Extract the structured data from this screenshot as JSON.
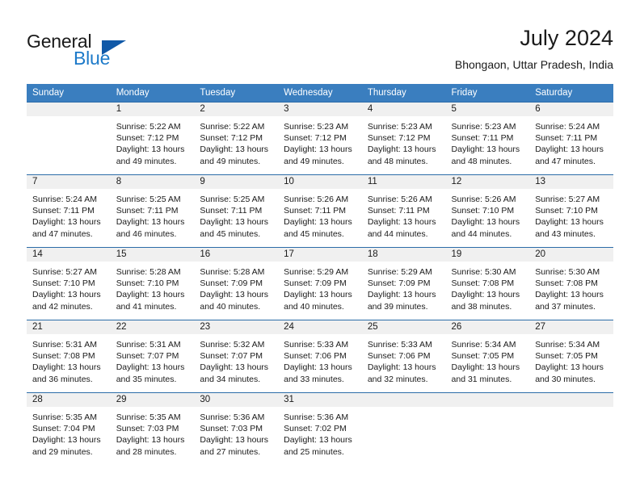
{
  "logo": {
    "word1": "General",
    "word2": "Blue",
    "accent_color": "#1d7ac9",
    "triangle_color": "#1059a8"
  },
  "header": {
    "title": "July 2024",
    "subtitle": "Bhongaon, Uttar Pradesh, India"
  },
  "calendar": {
    "header_bg": "#3a7ebf",
    "daynum_bg": "#f0f0f0",
    "row_border": "#2c6ca8",
    "weekday_headers": [
      "Sunday",
      "Monday",
      "Tuesday",
      "Wednesday",
      "Thursday",
      "Friday",
      "Saturday"
    ],
    "weeks": [
      [
        {
          "day": "",
          "sunrise": "",
          "sunset": "",
          "daylight1": "",
          "daylight2": ""
        },
        {
          "day": "1",
          "sunrise": "Sunrise: 5:22 AM",
          "sunset": "Sunset: 7:12 PM",
          "daylight1": "Daylight: 13 hours",
          "daylight2": "and 49 minutes."
        },
        {
          "day": "2",
          "sunrise": "Sunrise: 5:22 AM",
          "sunset": "Sunset: 7:12 PM",
          "daylight1": "Daylight: 13 hours",
          "daylight2": "and 49 minutes."
        },
        {
          "day": "3",
          "sunrise": "Sunrise: 5:23 AM",
          "sunset": "Sunset: 7:12 PM",
          "daylight1": "Daylight: 13 hours",
          "daylight2": "and 49 minutes."
        },
        {
          "day": "4",
          "sunrise": "Sunrise: 5:23 AM",
          "sunset": "Sunset: 7:12 PM",
          "daylight1": "Daylight: 13 hours",
          "daylight2": "and 48 minutes."
        },
        {
          "day": "5",
          "sunrise": "Sunrise: 5:23 AM",
          "sunset": "Sunset: 7:11 PM",
          "daylight1": "Daylight: 13 hours",
          "daylight2": "and 48 minutes."
        },
        {
          "day": "6",
          "sunrise": "Sunrise: 5:24 AM",
          "sunset": "Sunset: 7:11 PM",
          "daylight1": "Daylight: 13 hours",
          "daylight2": "and 47 minutes."
        }
      ],
      [
        {
          "day": "7",
          "sunrise": "Sunrise: 5:24 AM",
          "sunset": "Sunset: 7:11 PM",
          "daylight1": "Daylight: 13 hours",
          "daylight2": "and 47 minutes."
        },
        {
          "day": "8",
          "sunrise": "Sunrise: 5:25 AM",
          "sunset": "Sunset: 7:11 PM",
          "daylight1": "Daylight: 13 hours",
          "daylight2": "and 46 minutes."
        },
        {
          "day": "9",
          "sunrise": "Sunrise: 5:25 AM",
          "sunset": "Sunset: 7:11 PM",
          "daylight1": "Daylight: 13 hours",
          "daylight2": "and 45 minutes."
        },
        {
          "day": "10",
          "sunrise": "Sunrise: 5:26 AM",
          "sunset": "Sunset: 7:11 PM",
          "daylight1": "Daylight: 13 hours",
          "daylight2": "and 45 minutes."
        },
        {
          "day": "11",
          "sunrise": "Sunrise: 5:26 AM",
          "sunset": "Sunset: 7:11 PM",
          "daylight1": "Daylight: 13 hours",
          "daylight2": "and 44 minutes."
        },
        {
          "day": "12",
          "sunrise": "Sunrise: 5:26 AM",
          "sunset": "Sunset: 7:10 PM",
          "daylight1": "Daylight: 13 hours",
          "daylight2": "and 44 minutes."
        },
        {
          "day": "13",
          "sunrise": "Sunrise: 5:27 AM",
          "sunset": "Sunset: 7:10 PM",
          "daylight1": "Daylight: 13 hours",
          "daylight2": "and 43 minutes."
        }
      ],
      [
        {
          "day": "14",
          "sunrise": "Sunrise: 5:27 AM",
          "sunset": "Sunset: 7:10 PM",
          "daylight1": "Daylight: 13 hours",
          "daylight2": "and 42 minutes."
        },
        {
          "day": "15",
          "sunrise": "Sunrise: 5:28 AM",
          "sunset": "Sunset: 7:10 PM",
          "daylight1": "Daylight: 13 hours",
          "daylight2": "and 41 minutes."
        },
        {
          "day": "16",
          "sunrise": "Sunrise: 5:28 AM",
          "sunset": "Sunset: 7:09 PM",
          "daylight1": "Daylight: 13 hours",
          "daylight2": "and 40 minutes."
        },
        {
          "day": "17",
          "sunrise": "Sunrise: 5:29 AM",
          "sunset": "Sunset: 7:09 PM",
          "daylight1": "Daylight: 13 hours",
          "daylight2": "and 40 minutes."
        },
        {
          "day": "18",
          "sunrise": "Sunrise: 5:29 AM",
          "sunset": "Sunset: 7:09 PM",
          "daylight1": "Daylight: 13 hours",
          "daylight2": "and 39 minutes."
        },
        {
          "day": "19",
          "sunrise": "Sunrise: 5:30 AM",
          "sunset": "Sunset: 7:08 PM",
          "daylight1": "Daylight: 13 hours",
          "daylight2": "and 38 minutes."
        },
        {
          "day": "20",
          "sunrise": "Sunrise: 5:30 AM",
          "sunset": "Sunset: 7:08 PM",
          "daylight1": "Daylight: 13 hours",
          "daylight2": "and 37 minutes."
        }
      ],
      [
        {
          "day": "21",
          "sunrise": "Sunrise: 5:31 AM",
          "sunset": "Sunset: 7:08 PM",
          "daylight1": "Daylight: 13 hours",
          "daylight2": "and 36 minutes."
        },
        {
          "day": "22",
          "sunrise": "Sunrise: 5:31 AM",
          "sunset": "Sunset: 7:07 PM",
          "daylight1": "Daylight: 13 hours",
          "daylight2": "and 35 minutes."
        },
        {
          "day": "23",
          "sunrise": "Sunrise: 5:32 AM",
          "sunset": "Sunset: 7:07 PM",
          "daylight1": "Daylight: 13 hours",
          "daylight2": "and 34 minutes."
        },
        {
          "day": "24",
          "sunrise": "Sunrise: 5:33 AM",
          "sunset": "Sunset: 7:06 PM",
          "daylight1": "Daylight: 13 hours",
          "daylight2": "and 33 minutes."
        },
        {
          "day": "25",
          "sunrise": "Sunrise: 5:33 AM",
          "sunset": "Sunset: 7:06 PM",
          "daylight1": "Daylight: 13 hours",
          "daylight2": "and 32 minutes."
        },
        {
          "day": "26",
          "sunrise": "Sunrise: 5:34 AM",
          "sunset": "Sunset: 7:05 PM",
          "daylight1": "Daylight: 13 hours",
          "daylight2": "and 31 minutes."
        },
        {
          "day": "27",
          "sunrise": "Sunrise: 5:34 AM",
          "sunset": "Sunset: 7:05 PM",
          "daylight1": "Daylight: 13 hours",
          "daylight2": "and 30 minutes."
        }
      ],
      [
        {
          "day": "28",
          "sunrise": "Sunrise: 5:35 AM",
          "sunset": "Sunset: 7:04 PM",
          "daylight1": "Daylight: 13 hours",
          "daylight2": "and 29 minutes."
        },
        {
          "day": "29",
          "sunrise": "Sunrise: 5:35 AM",
          "sunset": "Sunset: 7:03 PM",
          "daylight1": "Daylight: 13 hours",
          "daylight2": "and 28 minutes."
        },
        {
          "day": "30",
          "sunrise": "Sunrise: 5:36 AM",
          "sunset": "Sunset: 7:03 PM",
          "daylight1": "Daylight: 13 hours",
          "daylight2": "and 27 minutes."
        },
        {
          "day": "31",
          "sunrise": "Sunrise: 5:36 AM",
          "sunset": "Sunset: 7:02 PM",
          "daylight1": "Daylight: 13 hours",
          "daylight2": "and 25 minutes."
        },
        {
          "day": "",
          "sunrise": "",
          "sunset": "",
          "daylight1": "",
          "daylight2": ""
        },
        {
          "day": "",
          "sunrise": "",
          "sunset": "",
          "daylight1": "",
          "daylight2": ""
        },
        {
          "day": "",
          "sunrise": "",
          "sunset": "",
          "daylight1": "",
          "daylight2": ""
        }
      ]
    ]
  }
}
